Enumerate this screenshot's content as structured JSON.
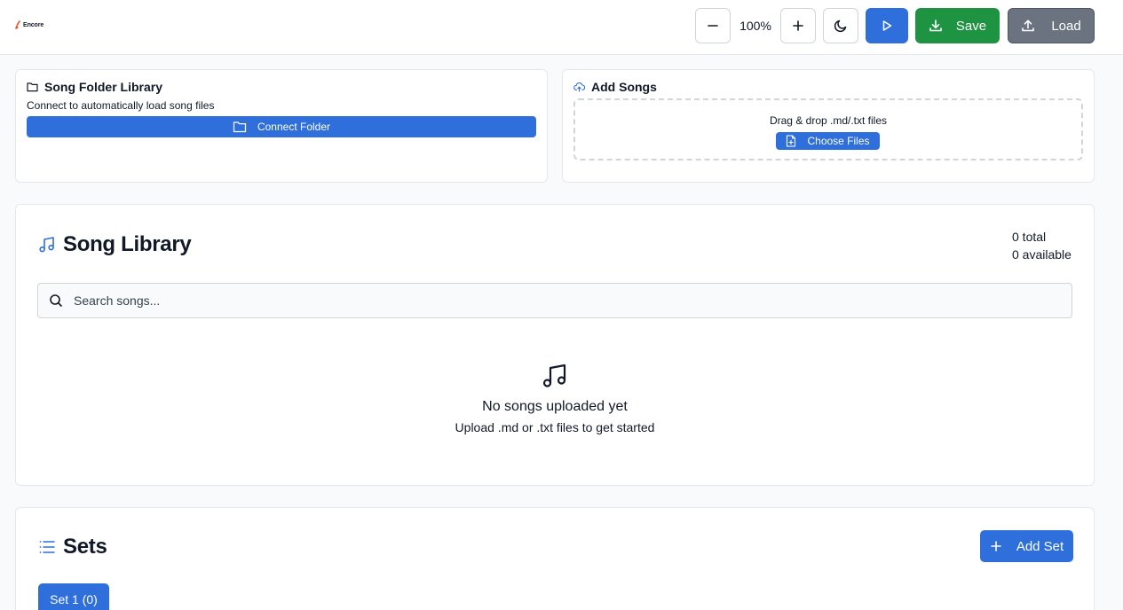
{
  "header": {
    "logo_text": "Encore",
    "zoom_level": "100%",
    "save_label": "Save",
    "load_label": "Load"
  },
  "folder_library": {
    "title": "Song Folder Library",
    "description": "Connect to automatically load song files",
    "connect_label": "Connect Folder"
  },
  "add_songs": {
    "title": "Add Songs",
    "drop_text": "Drag & drop .md/.txt files",
    "choose_label": "Choose Files"
  },
  "song_library": {
    "title": "Song Library",
    "total": "0 total",
    "available": "0 available",
    "search_placeholder": "Search songs...",
    "empty_title": "No songs uploaded yet",
    "empty_subtitle": "Upload .md or .txt files to get started"
  },
  "sets": {
    "title": "Sets",
    "add_label": "Add Set",
    "tabs": [
      {
        "label": "Set 1 (0)"
      }
    ]
  },
  "colors": {
    "primary": "#2f6fdc",
    "success": "#1e9443",
    "secondary": "#6b7280",
    "logo_accent": "#e4572e"
  },
  "icons": {
    "zoom_out": "minus-icon",
    "zoom_in": "plus-icon",
    "theme": "moon-icon",
    "play": "play-icon",
    "save": "download-icon",
    "load": "upload-icon",
    "folder": "folder-icon",
    "add_songs": "cloud-upload-icon",
    "choose_files": "file-plus-icon",
    "library": "music-note-icon",
    "search": "search-icon",
    "sets": "list-icon",
    "add_set": "plus-icon"
  }
}
